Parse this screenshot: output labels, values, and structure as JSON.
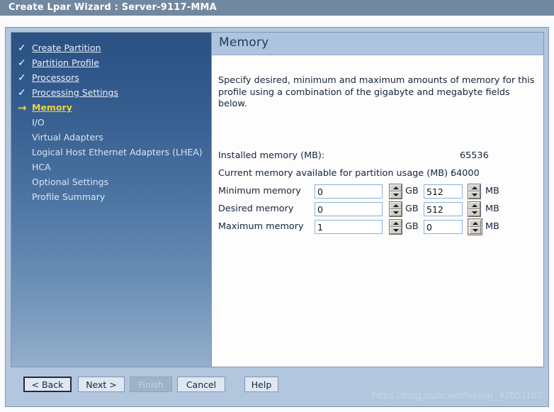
{
  "window": {
    "title": "Create Lpar Wizard : Server-9117-MMA"
  },
  "sidebar": {
    "items": [
      {
        "label": "Create Partition",
        "mark": "✓",
        "state": "done"
      },
      {
        "label": "Partition Profile",
        "mark": "✓",
        "state": "done"
      },
      {
        "label": "Processors",
        "mark": "✓",
        "state": "done"
      },
      {
        "label": "Processing Settings",
        "mark": "✓",
        "state": "done"
      },
      {
        "label": "Memory",
        "mark": "→",
        "state": "current"
      },
      {
        "label": "I/O",
        "mark": "",
        "state": "plain"
      },
      {
        "label": "Virtual Adapters",
        "mark": "",
        "state": "plain"
      },
      {
        "label": "Logical Host Ethernet Adapters (LHEA)",
        "mark": "",
        "state": "plain"
      },
      {
        "label": "HCA",
        "mark": "",
        "state": "plain"
      },
      {
        "label": "Optional Settings",
        "mark": "",
        "state": "plain"
      },
      {
        "label": "Profile Summary",
        "mark": "",
        "state": "plain"
      }
    ]
  },
  "content": {
    "header": "Memory",
    "intro": "Specify desired, minimum and maximum amounts of memory for this profile using a combination of the gigabyte and megabyte fields below.",
    "info": [
      {
        "label": "Installed memory (MB):",
        "value": "65536"
      },
      {
        "label": "Current memory available for partition usage (MB) :",
        "value": "64000"
      }
    ],
    "memory_rows": [
      {
        "label": "Minimum memory",
        "gb": "0",
        "gb_unit": "GB",
        "mb": "512",
        "mb_unit": "MB",
        "mb_spinner_focused": false
      },
      {
        "label": "Desired memory",
        "gb": "0",
        "gb_unit": "GB",
        "mb": "512",
        "mb_unit": "MB",
        "mb_spinner_focused": false
      },
      {
        "label": "Maximum memory",
        "gb": "1",
        "gb_unit": "GB",
        "mb": "0",
        "mb_unit": "MB",
        "mb_spinner_focused": true
      }
    ]
  },
  "buttons": {
    "back": "< Back",
    "next": "Next >",
    "finish": "Finish",
    "cancel": "Cancel",
    "help": "Help"
  },
  "watermark": "https://blog.csdn.net/weixin_42051187",
  "colors": {
    "titlebar": "#72889f",
    "dialog_bg": "#b2c6dd",
    "sidebar_top": "#2b5183",
    "sidebar_bottom": "#93afcc",
    "header_bg": "#aec3dd",
    "header_text": "#1c3c66",
    "current_item": "#f2d23a"
  }
}
